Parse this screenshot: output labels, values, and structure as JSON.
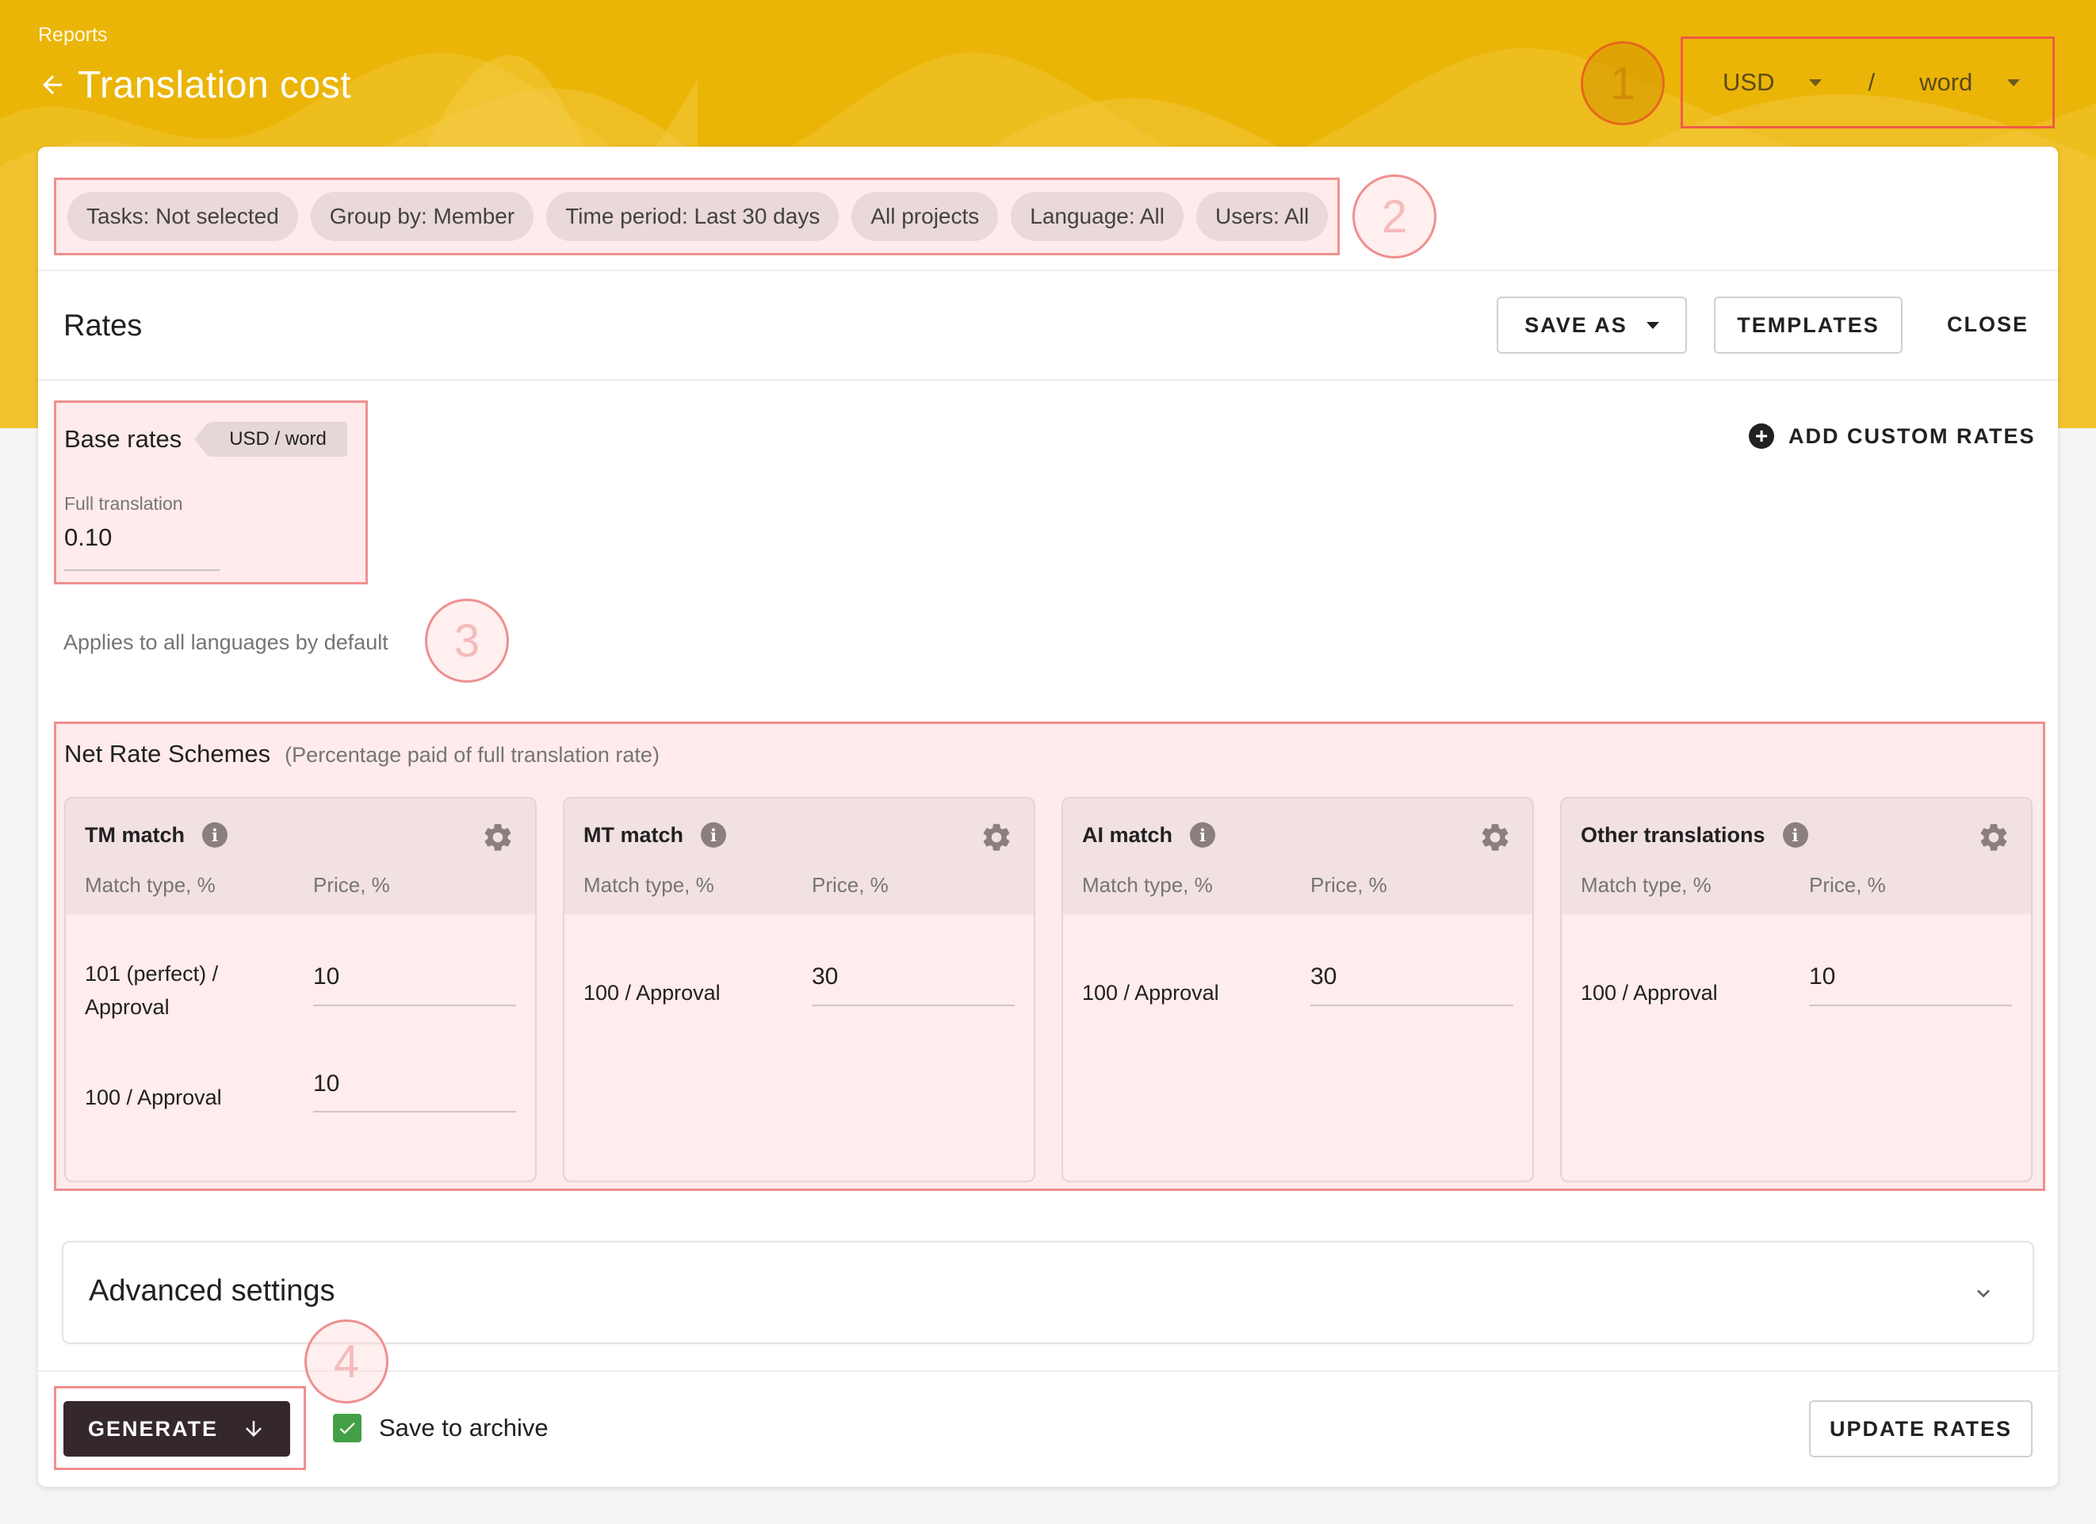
{
  "header": {
    "breadcrumb": "Reports",
    "title": "Translation cost",
    "currency": "USD",
    "separator": "/",
    "unit": "word"
  },
  "markers": [
    "1",
    "2",
    "3",
    "4"
  ],
  "filters": [
    "Tasks: Not selected",
    "Group by: Member",
    "Time period: Last 30 days",
    "All projects",
    "Language: All",
    "Users: All"
  ],
  "rates": {
    "title": "Rates",
    "save_as": "SAVE AS",
    "templates": "TEMPLATES",
    "close": "CLOSE"
  },
  "base_rates": {
    "title": "Base rates",
    "unit_chip": "USD / word",
    "field_label": "Full translation",
    "field_value": "0.10",
    "applies_note": "Applies to all languages by default",
    "add_custom": "ADD CUSTOM RATES"
  },
  "net_rate": {
    "title": "Net Rate Schemes",
    "subtitle": "(Percentage paid of full translation rate)",
    "col_match": "Match type, %",
    "col_price": "Price, %",
    "schemes": [
      {
        "name": "TM match",
        "rows": [
          {
            "type": "101 (perfect) / Approval",
            "price": "10"
          },
          {
            "type": "100 / Approval",
            "price": "10"
          }
        ]
      },
      {
        "name": "MT match",
        "rows": [
          {
            "type": "100 / Approval",
            "price": "30"
          }
        ]
      },
      {
        "name": "AI match",
        "rows": [
          {
            "type": "100 / Approval",
            "price": "30"
          }
        ]
      },
      {
        "name": "Other translations",
        "rows": [
          {
            "type": "100 / Approval",
            "price": "10"
          }
        ]
      }
    ]
  },
  "advanced": {
    "title": "Advanced settings"
  },
  "footer": {
    "generate": "GENERATE",
    "save_archive": "Save to archive",
    "update_rates": "UPDATE RATES"
  },
  "colors": {
    "header_bg": "#ebb508",
    "highlight_border": "#ef8f8f",
    "generate_bg": "#35282b",
    "checkbox": "#43a047"
  }
}
